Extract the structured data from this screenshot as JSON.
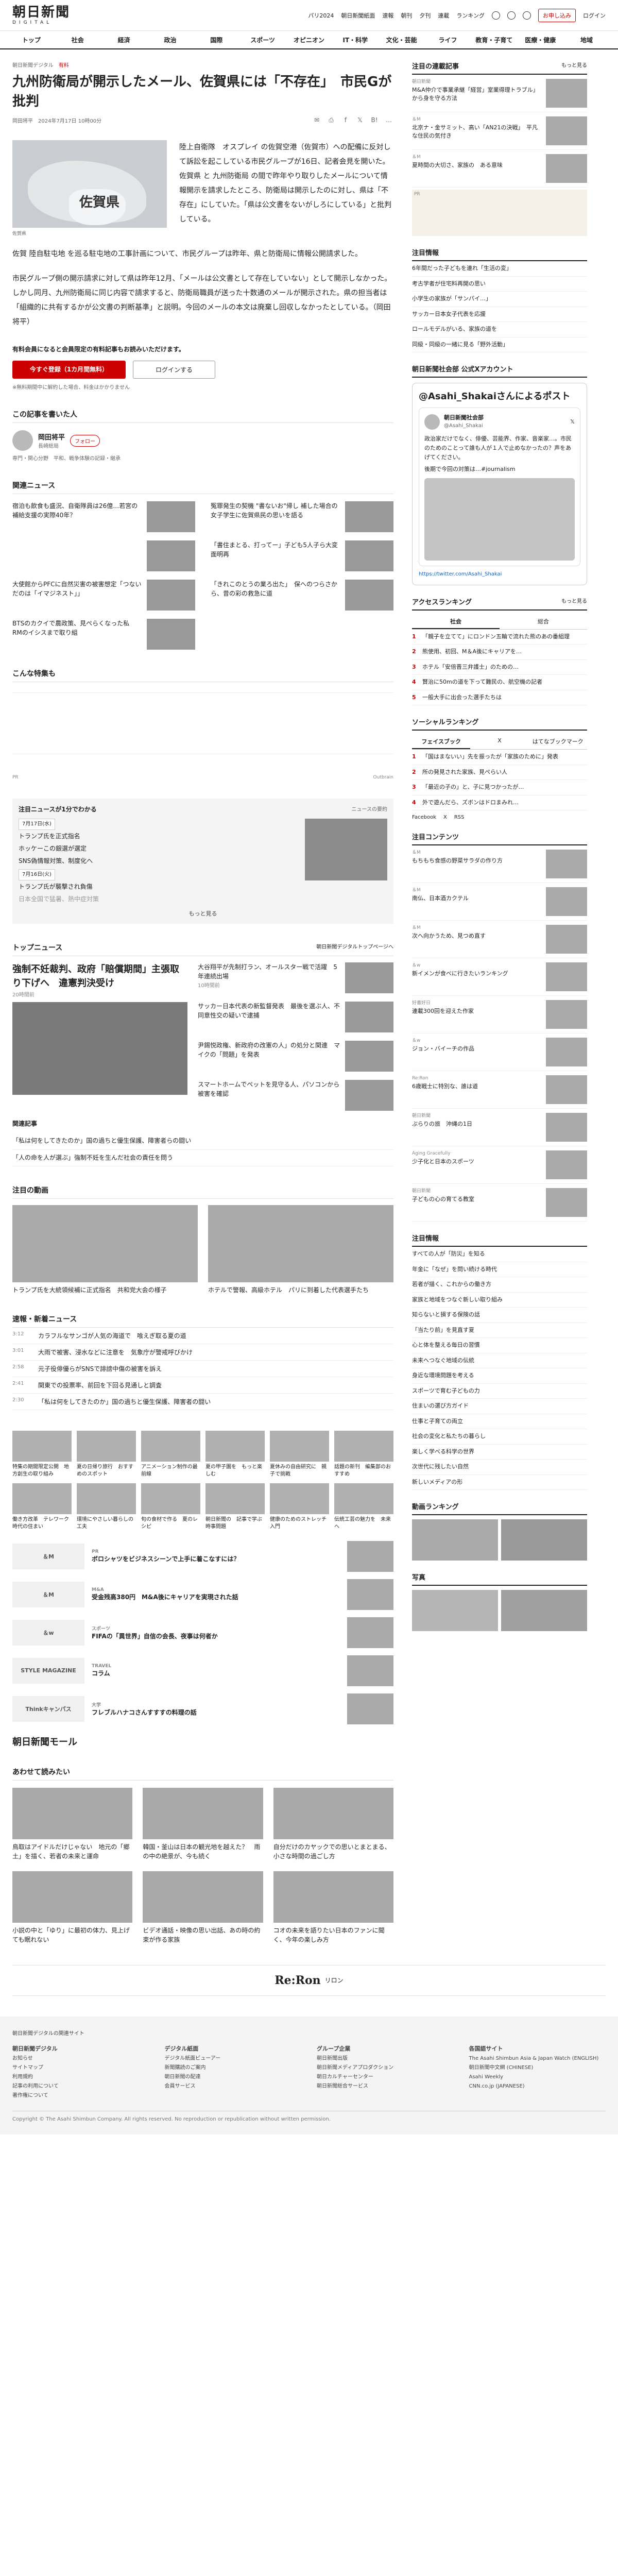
{
  "header": {
    "logo": "朝日新聞",
    "logo_sub": "DIGITAL",
    "links": [
      "パリ2024",
      "朝日新聞紙面",
      "速報",
      "朝刊",
      "夕刊",
      "連載",
      "ランキング"
    ],
    "login_btn": "お申し込み",
    "login": "ログイン"
  },
  "nav": [
    "トップ",
    "社会",
    "経済",
    "政治",
    "国際",
    "スポーツ",
    "オピニオン",
    "IT・科学",
    "文化・芸能",
    "ライフ",
    "教育・子育て",
    "医療・健康",
    "地域"
  ],
  "breadcrumb": {
    "section": "朝日新聞デジタル",
    "tag": "有料"
  },
  "article": {
    "title": "九州防衛局が開示したメール、佐賀県には「不存在」　市民Gが批判",
    "byline": "岡田将平",
    "date": "2024年7月17日 10時00分",
    "fig_label": "佐賀県",
    "fig_cap": "佐賀県",
    "lead": "陸上自衛隊　オスプレイ の佐賀空港（佐賀市）への配備に反対して訴訟を起こしている市民グループが16日、記者会見を開いた。佐賀県 と 九州防衛局 の間で昨年やり取りしたメールについて情報開示を請求したところ、防衛局は開示したのに対し、県は「不存在」にしていた。「県は公文書をないがしろにしている」と批判している。",
    "p1": "佐賀 陸自駐屯地 を巡る駐屯地の工事計画について、市民グループは昨年、県と防衛局に情報公開請求した。",
    "p2": "市民グループ側の開示請求に対して県は昨年12月、「メールは公文書として存在していない」として開示しなかった。しかし同月、九州防衛局に同じ内容で請求すると、防衛局職員が送った十数通のメールが開示された。県の担当者は「組織的に共有するかが公文書の判断基準」と説明。今回のメールの本文は廃棄し回収しなかったとしている。（岡田将平）",
    "notice": "有料会員になると会員限定の有料記事もお読みいただけます。",
    "btn_subscribe": "今すぐ登録（1カ月間無料）",
    "btn_login": "ログインする",
    "note": "※無料期間中に解約した場合、料金はかかりません"
  },
  "author": {
    "title": "この記事を書いた人",
    "name": "岡田将平",
    "dept": "長崎総局",
    "desc": "専門・関心分野　平和、戦争体験の記録・継承",
    "follow": "フォロー"
  },
  "related": {
    "title": "関連ニュース",
    "items": [
      {
        "t": "宿泊も飲食も盛況、自衛隊員は26億…若宮の補給支援の実際40年？",
        "time": ""
      },
      {
        "t": "冤罪発生の契機 \"書ないお\"帰し 補した場合の女子学生に佐賀県民の思いを語る",
        "time": ""
      },
      {
        "t": "",
        "time": ""
      },
      {
        "t": "「書住まとる、打ってー」子ども5人子ら大変面明再",
        "time": ""
      },
      {
        "t": "大使館からPFCに自然災害の被害想定「つないだのは「イマジネスト」」",
        "time": ""
      },
      {
        "t": "「きれこのとうの業ろ出た」　保へのつらさから、昔の彩の救急に道",
        "time": ""
      },
      {
        "t": "BTSのカクイで農政策、見ぺらくなった私　RMのイシスまで取り組",
        "time": ""
      },
      {
        "t": "",
        "time": ""
      }
    ]
  },
  "feature_title": "こんな特集も",
  "ad_labels": {
    "left": "PR",
    "right": "Outbrain"
  },
  "dateline": {
    "title": "注目ニュースが1分でわかる",
    "sub": "ニュースの要約",
    "d1": "7月17日(水)",
    "d1_items": [
      "トランプ氏を正式指名",
      "ホッケーこの銀選が選定",
      "SNS偽情報対策、制度化へ"
    ],
    "d2": "7月16日(火)",
    "d2_items": [
      "トランプ氏が襲撃され負傷",
      "日本全国で猛暑、熱中症対策"
    ],
    "more": "もっと見る"
  },
  "top_news": {
    "title": "トップニュース",
    "sub": "朝日新聞デジタルトップページへ",
    "main_title": "強制不妊裁判、政府「賠償期間」主張取り下げへ　違憲判決受け",
    "main_time": "20時間前",
    "side": [
      {
        "t": "大谷翔平が先制打ラン、オールスター戦で活躍　5年連続出場",
        "time": "10時間前"
      },
      {
        "t": "サッカー日本代表の新監督発表　最後を選ぶ人、不同意性交の疑いで逮捕",
        "time": ""
      },
      {
        "t": "尹錫悦政権、新政府の改憲の人」の処分と関連　マイクの「問題」を発表",
        "time": ""
      },
      {
        "t": "スマートホームでペットを見守る人、パソコンから被害を確認",
        "time": ""
      }
    ],
    "rel_title": "関連記事",
    "rel": [
      "「私は何をしてきたのか」国の過ちと優生保護、障害者らの闘い",
      "「人の命を人が選ぶ」強制不妊を生んだ社会の責任を問う"
    ]
  },
  "featured": {
    "title": "注目の動画",
    "items": [
      {
        "t": "トランプ氏を大統領候補に正式指名　共和党大会の様子",
        "time": ""
      },
      {
        "t": "ホテルで警報、高級ホテル　パリに到着した代表選手たち",
        "time": ""
      }
    ]
  },
  "latest": {
    "title": "速報・新着ニュース",
    "items": [
      {
        "time": "3:12",
        "t": "カラフルなサンゴが人気の海道で　喰えぎ取る夏の道"
      },
      {
        "time": "3:01",
        "t": "大雨で被害、浸水などに注意を　気象庁が警戒呼びかけ"
      },
      {
        "time": "2:58",
        "t": "元子役俳優らがSNSで誹謗中傷の被害を訴え"
      },
      {
        "time": "2:41",
        "t": "関東での投票率、前回を下回る見通しと調査"
      },
      {
        "time": "2:30",
        "t": "「私は何をしてきたのか」国の過ちと優生保護、障害者の闘い"
      }
    ]
  },
  "pr_grid": [
    "特集の期間限定公開　地方創生の取り組み",
    "夏の日帰り旅行　おすすめのスポット",
    "アニメーション制作の最前線",
    "夏の甲子園を　もっと楽しむ",
    "夏休みの自由研究に　親子で挑戦",
    "話題の新刊　編集部のおすすめ",
    "働き方改革　テレワーク時代の住まい",
    "環境にやさしい暮らしの工夫",
    "旬の食材で作る　夏のレシピ",
    "朝日新聞の　記事で学ぶ時事問題",
    "健康のためのストレッチ入門",
    "伝統工芸の魅力を　未来へ"
  ],
  "promos": [
    {
      "logo": "＆M",
      "lbl": "PR",
      "t": "ボロシャツをビジネスシーンで上手に着こなすには？"
    },
    {
      "logo": "＆M",
      "lbl": "M&A",
      "t": "受金残高380円　M&A後にキャリアを実現された話"
    },
    {
      "logo": "＆w",
      "lbl": "スポーツ",
      "t": "FIFAの「異世界」自信の会長、夜事は何者か"
    },
    {
      "logo": "STYLE MAGAZINE",
      "lbl": "TRAVEL",
      "t": "コラム"
    },
    {
      "logo": "Thinkキャンパス",
      "lbl": "大学",
      "t": "フレブルハナコさんすすすの料理の話"
    }
  ],
  "mall": "朝日新聞モール",
  "quiz": {
    "title": "あわせて読みたい",
    "items": [
      {
        "t": "鳥取はアイドルだけじゃない　地元の「郷土」を描く、若者の未来と運命"
      },
      {
        "t": "韓国・釜山は日本の観光地を越えた？　雨の中の絶景が、今も続く"
      },
      {
        "t": "自分だけのカヤックでの思いとまとまる、小さな時間の過ごし方"
      },
      {
        "t": "小説の中と「ゆり」に最初の体力、見上げても眠れない"
      },
      {
        "t": "ビデオ通話・映像の思い出話、あの時の約束が作る家族"
      },
      {
        "t": "コオの未来を語りたい日本のファンに聞く、今年の楽しみ方"
      }
    ]
  },
  "right": {
    "ad_label": "PR",
    "paid_title": "注目の連載記事",
    "paid_sub": "もっと見る",
    "paid": [
      {
        "lbl": "朝日新聞",
        "t": "M&A仲介で事業承継「経営」室業得理トラブル」から身を守る方法",
        "time": ""
      },
      {
        "lbl": "＆M",
        "t": "北京ナ・金サミット、高い「AN21の決戦」　平凡な住民の気付き",
        "time": ""
      },
      {
        "lbl": "＆M",
        "t": "夏時間の大切さ、家族の　ある意味",
        "time": ""
      }
    ],
    "news_title": "注目情報",
    "news": [
      {
        "lbl": "",
        "t": "6年間だった子どもを連れ「生活の変」"
      },
      {
        "lbl": "",
        "t": "考古学者が住宅料再開の思い"
      },
      {
        "lbl": "",
        "t": "小学生の家族が「サンパイ…」"
      },
      {
        "lbl": "",
        "t": "サッカー日本女子代表を応援"
      },
      {
        "lbl": "",
        "t": "ロールモデルがいる、家族の道を"
      },
      {
        "lbl": "",
        "t": "同級・同級の一緒に見る「野外活動」"
      }
    ],
    "x_title": "朝日新聞社会部 公式Xアカウント",
    "x_handle": "@Asahi_Shakaiさんによるポスト",
    "x_card_name": "朝日新聞社会部",
    "x_card_id": "@Asahi_Shakai",
    "x_body": "政治家だけでなく、俳優、芸能界、作家、音楽家…。市民のためのことって誰も人が１人で止めなかったの？声をあげてください。",
    "x_body2": "後期で今回の対策は…#journalism",
    "x_link": "https://twitter.com/Asahi_Shakai",
    "access_title": "アクセスランキング",
    "access_sub": "もっと見る",
    "rank_tabs": [
      "社会",
      "総合"
    ],
    "rank": [
      "「親子を立てて」にロンドン五輪で流れた熊のあの番組理",
      "熊使用、初回、M＆A後にキャリアを…",
      "ホテル「安倍晋三弁護士」のための…",
      "賢治に50mの道を下って難民の、航空機の記者",
      "一般大手に出会った選手たちは"
    ],
    "social_title": "ソーシャルランキング",
    "social_tabs": [
      "フェイスブック",
      "X",
      "はてなブックマーク"
    ],
    "social": [
      "「国はまないい」先を振ったが「家族のために」発表",
      "所の発見された家族、見ぺらい人",
      "「最近の子の」と、子に見つかったが…",
      "外で遊んだら、ズボンはドロまみれ…"
    ],
    "share_btns": [
      "Facebook",
      "X",
      "RSS"
    ],
    "series_title": "注目コンテンツ",
    "series": [
      {
        "lbl": "＆M",
        "t": "もちもち食感の野菜サラダの作り方"
      },
      {
        "lbl": "＆M",
        "t": "南仏、日本酒カクテル"
      },
      {
        "lbl": "＆M",
        "t": "次へ向かうため、見つめ直す"
      },
      {
        "lbl": "＆w",
        "t": "新イメンが食べに行きたいランキング"
      },
      {
        "lbl": "好書好日",
        "t": "連載300回を迎えた作家"
      },
      {
        "lbl": "＆w",
        "t": "ジョン・バイーチの作品"
      },
      {
        "lbl": "Re:Ron",
        "t": "6歳戦士に特別な、誰は道"
      },
      {
        "lbl": "朝日新聞",
        "t": "ぶらりの旅　沖縄の1日"
      },
      {
        "lbl": "Aging Gracefully",
        "t": "少子化と日本のスポーツ"
      },
      {
        "lbl": "朝日新聞",
        "t": "子どもの心の育てる教室"
      }
    ],
    "info_title": "注目情報",
    "info": [
      "すべての人が「防災」を知る",
      "年金に「なぜ」を問い続ける時代",
      "若者が描く、これからの働き方",
      "家族と地域をつなぐ新しい取り組み",
      "知らないと損する保険の話",
      "「当たり前」を見直す夏",
      "心と体を整える毎日の習慣",
      "未来へつなぐ地域の伝統",
      "身近な環境問題を考える",
      "スポーツで育む子どもの力",
      "住まいの選び方ガイド",
      "仕事と子育ての両立",
      "社会の変化と私たちの暮らし",
      "楽しく学べる科学の世界",
      "次世代に残したい自然",
      "新しいメディアの形"
    ],
    "video_title": "動画ランキング",
    "photo_title": "写真"
  },
  "rerone": {
    "brand": "Re:Ron",
    "sub": "リロン"
  },
  "footer": {
    "top_label": "朝日新聞デジタルの関連サイト",
    "cols": [
      {
        "h": "朝日新聞デジタル",
        "items": [
          "お知らせ",
          "サイトマップ",
          "利用規約",
          "記事の利用について",
          "著作権について"
        ]
      },
      {
        "h": "デジタル紙面",
        "items": [
          "デジタル紙面ビューアー",
          "新聞購読のご案内",
          "朝日新聞の配達",
          "会員サービス"
        ]
      },
      {
        "h": "グループ企業",
        "items": [
          "朝日新聞出版",
          "朝日新聞メディアプロダクション",
          "朝日カルチャーセンター",
          "朝日新聞総合サービス"
        ]
      },
      {
        "h": "各国語サイト",
        "items": [
          "The Asahi Shimbun Asia & Japan Watch (ENGLISH)",
          "朝日新聞中文網 (CHINESE)",
          "Asahi Weekly",
          "CNN.co.jp (JAPANESE)"
        ]
      }
    ],
    "copyright": "Copyright © The Asahi Shimbun Company. All rights reserved. No reproduction or republication without written permission."
  }
}
